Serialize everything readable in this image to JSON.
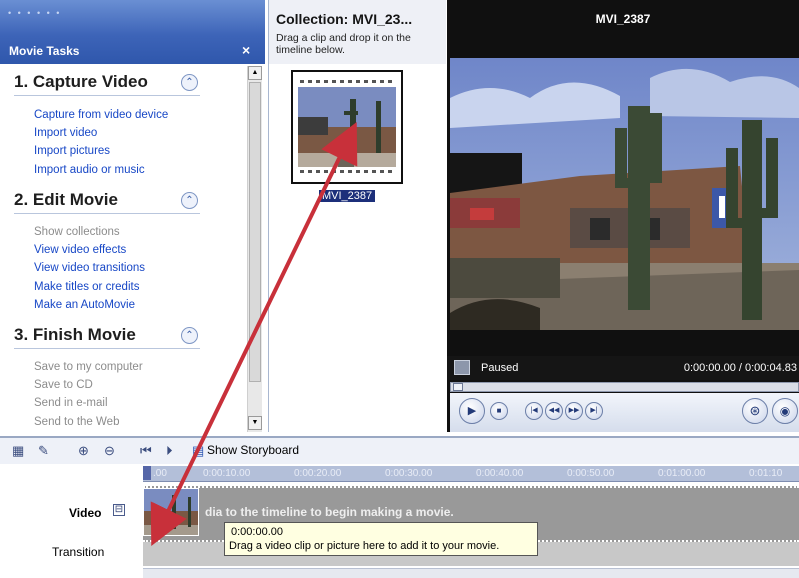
{
  "tasks_pane": {
    "title": "Movie Tasks",
    "close_glyph": "×",
    "sections": [
      {
        "title": "1. Capture Video",
        "toggle_glyph": "⌃",
        "items": [
          {
            "label": "Capture from video device",
            "enabled": true
          },
          {
            "label": "Import video",
            "enabled": true
          },
          {
            "label": "Import pictures",
            "enabled": true
          },
          {
            "label": "Import audio or music",
            "enabled": true
          }
        ]
      },
      {
        "title": "2. Edit Movie",
        "toggle_glyph": "⌃",
        "items": [
          {
            "label": "Show collections",
            "enabled": false
          },
          {
            "label": "View video effects",
            "enabled": true
          },
          {
            "label": "View video transitions",
            "enabled": true
          },
          {
            "label": "Make titles or credits",
            "enabled": true
          },
          {
            "label": "Make an AutoMovie",
            "enabled": true
          }
        ]
      },
      {
        "title": "3. Finish Movie",
        "toggle_glyph": "⌃",
        "items": [
          {
            "label": "Save to my computer",
            "enabled": false
          },
          {
            "label": "Save to CD",
            "enabled": false
          },
          {
            "label": "Send in e-mail",
            "enabled": false
          },
          {
            "label": "Send to the Web",
            "enabled": false
          }
        ]
      }
    ]
  },
  "collection": {
    "title": "Collection: MVI_23...",
    "instruction": "Drag a clip and drop it on the timeline below.",
    "clip_label": "MVI_2387"
  },
  "monitor": {
    "title": "MVI_2387",
    "status": "Paused",
    "time": "0:00:00.00 / 0:00:04.83"
  },
  "timeline": {
    "show_storyboard": "Show Storyboard",
    "ruler_ticks": [
      "0:00:10.00",
      "0:00:20.00",
      "0:00:30.00",
      "0:00:40.00",
      "0:00:50.00",
      "0:01:00.00",
      "0:01:10"
    ],
    "ruler_start": ".00",
    "video_label": "Video",
    "expand_glyph": "⊟",
    "transition_label": "Transition",
    "track_hint": "dia to the timeline to begin making a movie.",
    "tooltip_time": "0:00:00.00",
    "tooltip_text": "Drag a video clip or picture here to add it to your movie."
  },
  "colors": {
    "header_blue": "#3d64b8",
    "link_blue": "#1747c6",
    "arrow_red": "#c8303a",
    "monitor_bg": "#101010"
  }
}
